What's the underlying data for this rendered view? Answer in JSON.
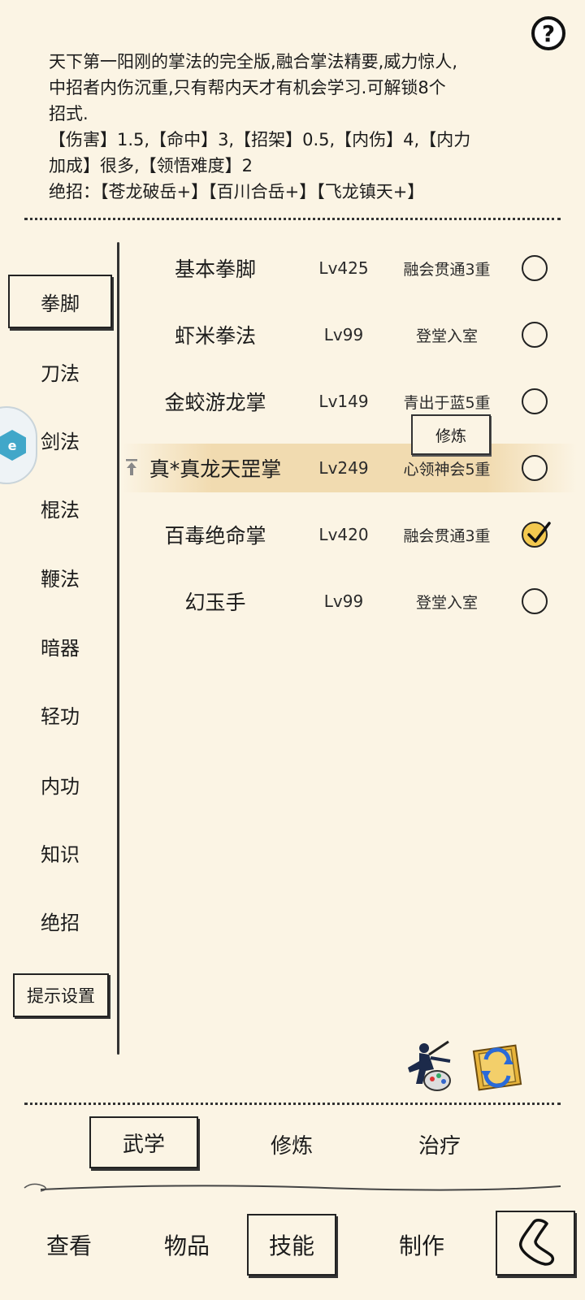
{
  "help": {
    "label": "?"
  },
  "description": {
    "lines": [
      "天下第一阳刚的掌法的完全版,融合掌法精要,威力惊人,",
      "中招者内伤沉重,只有帮内天才有机会学习.可解锁8个",
      "招式.",
      "【伤害】1.5,【命中】3,【招架】0.5,【内伤】4,【内力",
      "加成】很多,【领悟难度】2",
      "绝招：【苍龙破岳+】【百川合岳+】【飞龙镇天+】"
    ]
  },
  "sidebar": {
    "items": [
      {
        "label": "拳脚",
        "active": true
      },
      {
        "label": "刀法"
      },
      {
        "label": "剑法"
      },
      {
        "label": "棍法"
      },
      {
        "label": "鞭法"
      },
      {
        "label": "暗器"
      },
      {
        "label": "轻功"
      },
      {
        "label": "内功"
      },
      {
        "label": "知识"
      },
      {
        "label": "绝招"
      }
    ],
    "hint_settings": "提示设置"
  },
  "skills": [
    {
      "name": "基本拳脚",
      "level": "Lv425",
      "stage": "融会贯通3重",
      "checked": false
    },
    {
      "name": "虾米拳法",
      "level": "Lv99",
      "stage": "登堂入室",
      "checked": false
    },
    {
      "name": "金蛟游龙掌",
      "level": "Lv149",
      "stage": "青出于蓝5重",
      "checked": false
    },
    {
      "name": "真*真龙天罡掌",
      "level": "Lv249",
      "stage": "心领神会5重",
      "checked": false,
      "selected": true
    },
    {
      "name": "百毒绝命掌",
      "level": "Lv420",
      "stage": "融会贯通3重",
      "checked": true
    },
    {
      "name": "幻玉手",
      "level": "Lv99",
      "stage": "登堂入室",
      "checked": false
    }
  ],
  "practice_popup": {
    "label": "修炼"
  },
  "tabs": [
    {
      "label": "武学",
      "active": true
    },
    {
      "label": "修炼"
    },
    {
      "label": "治疗"
    }
  ],
  "nav": [
    {
      "label": "查看"
    },
    {
      "label": "物品"
    },
    {
      "label": "技能",
      "active": true
    },
    {
      "label": "制作"
    }
  ],
  "colors": {
    "background": "#fbf4e4",
    "highlight": "#f0d8aa",
    "check_fill": "#f3c94f"
  },
  "icons": [
    "help-icon",
    "scroll-app-icon",
    "martial-artist-icon",
    "scroll-swap-icon",
    "back-icon",
    "checkmark-icon",
    "pin-icon"
  ]
}
